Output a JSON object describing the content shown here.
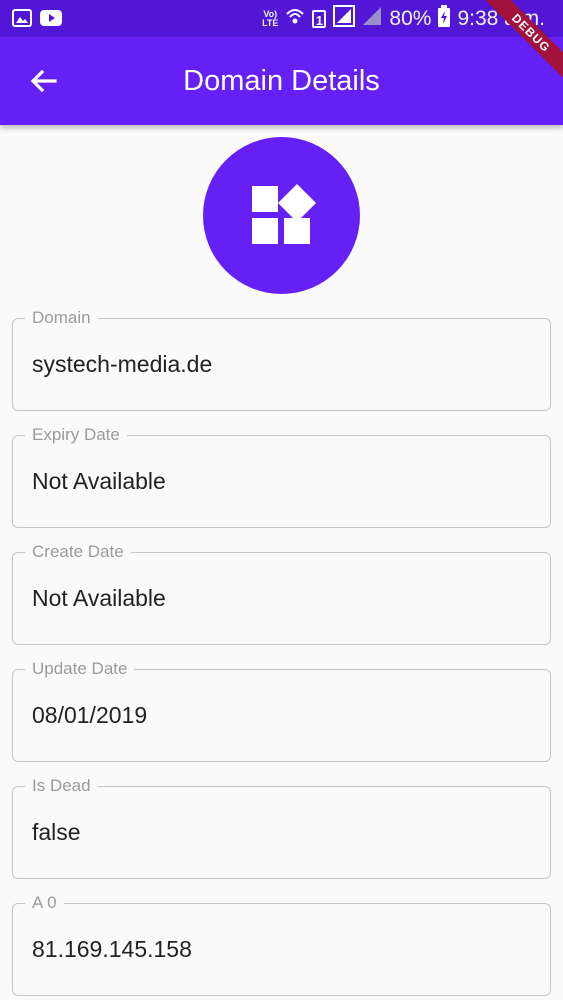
{
  "status_bar": {
    "left_icons": [
      "image-icon",
      "youtube-icon"
    ],
    "network_label_top": "Vo)",
    "network_label_bottom": "LTE",
    "sim_slot": "1",
    "battery": "80%",
    "time": "9:38 a.m."
  },
  "debug_banner": "DEBUG",
  "app_bar": {
    "back_icon": "arrow-back-icon",
    "title": "Domain Details"
  },
  "avatar": {
    "icon": "widgets-icon",
    "color": "#6420f5"
  },
  "fields": [
    {
      "label": "Domain",
      "value": "systech-media.de"
    },
    {
      "label": "Expiry Date",
      "value": "Not Available"
    },
    {
      "label": "Create Date",
      "value": "Not Available"
    },
    {
      "label": "Update Date",
      "value": "08/01/2019"
    },
    {
      "label": "Is Dead",
      "value": "false"
    },
    {
      "label": "A 0",
      "value": "81.169.145.158"
    }
  ],
  "colors": {
    "status_bar": "#5217d6",
    "app_bar": "#6420f5",
    "background": "#fafafa",
    "debug_banner": "#a3123a"
  }
}
